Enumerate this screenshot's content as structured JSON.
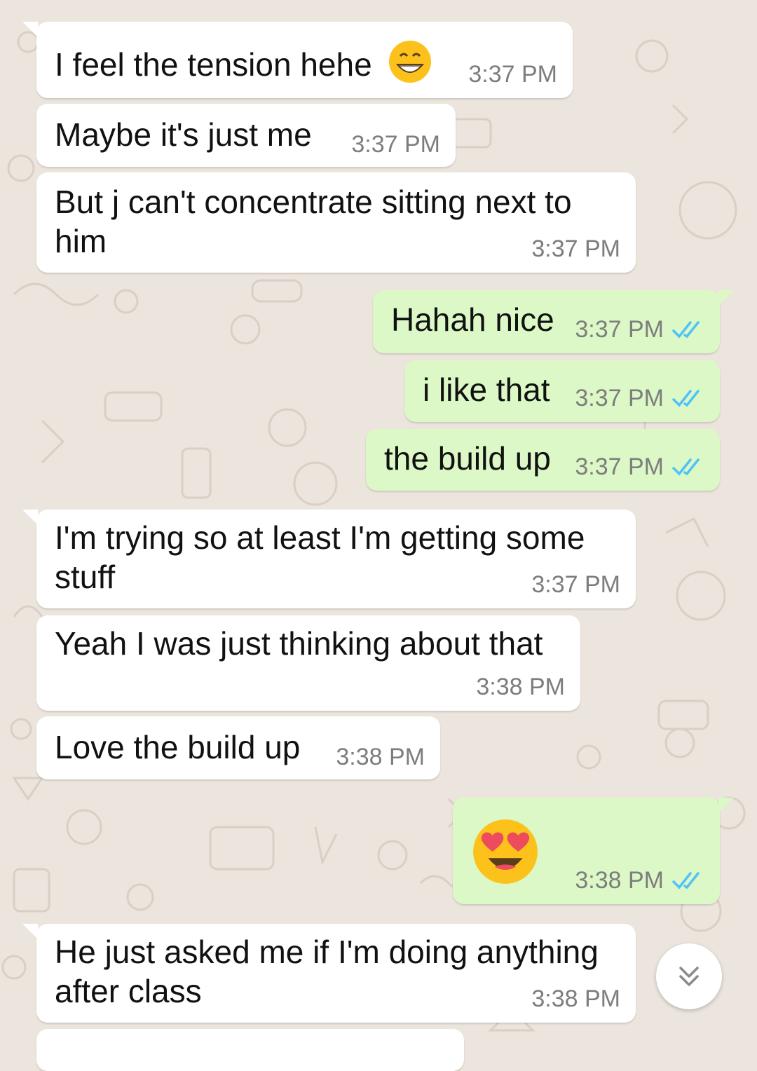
{
  "chat": {
    "messages": [
      {
        "direction": "incoming",
        "text": "I feel the tension hehe",
        "emoji": "grinning-face-with-smiling-eyes",
        "time": "3:37 PM"
      },
      {
        "direction": "incoming",
        "text": "Maybe it's just me",
        "time": "3:37 PM"
      },
      {
        "direction": "incoming",
        "text": "But j can't concentrate sitting next to him",
        "time": "3:37 PM"
      },
      {
        "direction": "outgoing",
        "text": "Hahah nice",
        "time": "3:37 PM",
        "status": "read"
      },
      {
        "direction": "outgoing",
        "text": "i like that",
        "time": "3:37 PM",
        "status": "read"
      },
      {
        "direction": "outgoing",
        "text": "the build up",
        "time": "3:37 PM",
        "status": "read"
      },
      {
        "direction": "incoming",
        "text": "I'm trying so at least I'm getting some stuff",
        "time": "3:37 PM"
      },
      {
        "direction": "incoming",
        "text": "Yeah I was just thinking about that",
        "time": "3:38 PM"
      },
      {
        "direction": "incoming",
        "text": "Love the build up",
        "time": "3:38 PM"
      },
      {
        "direction": "outgoing",
        "emoji": "smiling-face-with-heart-eyes",
        "time": "3:38 PM",
        "status": "read"
      },
      {
        "direction": "incoming",
        "text": "He just asked me if I'm doing anything after class",
        "time": "3:38 PM"
      }
    ]
  },
  "icons": {
    "read_ticks": "double-check-icon",
    "scroll_down": "chevron-double-down-icon"
  },
  "colors": {
    "wallpaper": "#ece5dd",
    "incoming_bubble": "#ffffff",
    "outgoing_bubble": "#dcf8c6",
    "read_ticks": "#4fc3f7",
    "timestamp": "#7d7d7d"
  }
}
